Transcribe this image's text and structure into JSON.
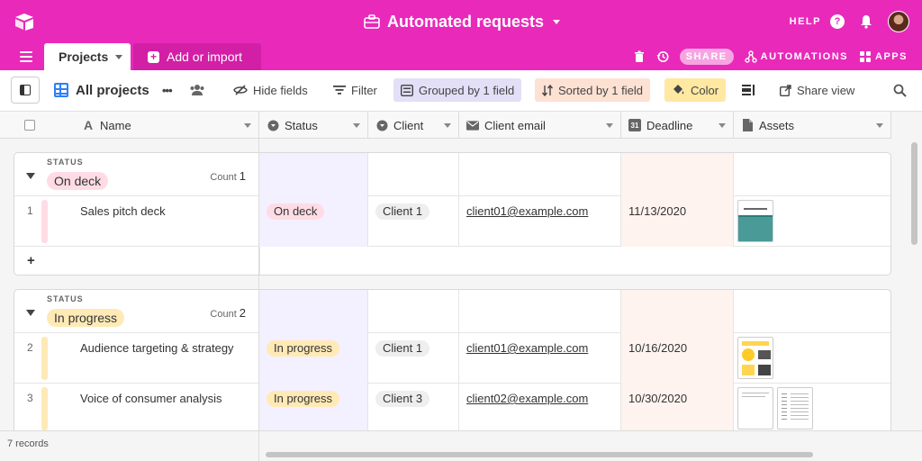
{
  "app": {
    "title": "Automated requests",
    "help_label": "HELP",
    "help_glyph": "?"
  },
  "tabs": {
    "active": "Projects",
    "add_import": "Add or import",
    "share": "SHARE",
    "automations": "AUTOMATIONS",
    "apps": "APPS"
  },
  "toolbar": {
    "view_name": "All projects",
    "more": "•••",
    "hide_fields": "Hide fields",
    "filter": "Filter",
    "grouped": "Grouped by 1 field",
    "sorted": "Sorted by 1 field",
    "color": "Color",
    "share_view": "Share view"
  },
  "columns": [
    {
      "label": "Name",
      "icon": "text-field-icon"
    },
    {
      "label": "Status",
      "icon": "single-select-icon"
    },
    {
      "label": "Client",
      "icon": "single-select-icon"
    },
    {
      "label": "Client email",
      "icon": "email-icon"
    },
    {
      "label": "Deadline",
      "icon": "calendar-icon"
    },
    {
      "label": "Assets",
      "icon": "attachment-icon"
    }
  ],
  "calendar_glyph": "31",
  "groups": [
    {
      "label": "STATUS",
      "value": "On deck",
      "count_label": "Count",
      "count": "1",
      "color": "#ffdce5",
      "rows": [
        {
          "num": "1",
          "name": "Sales pitch deck",
          "status": "On deck",
          "client": "Client 1",
          "email": "client01@example.com",
          "deadline": "11/13/2020"
        }
      ]
    },
    {
      "label": "STATUS",
      "value": "In progress",
      "count_label": "Count",
      "count": "2",
      "color": "#ffeab6",
      "rows": [
        {
          "num": "2",
          "name": "Audience targeting & strategy",
          "status": "In progress",
          "client": "Client 1",
          "email": "client01@example.com",
          "deadline": "10/16/2020"
        },
        {
          "num": "3",
          "name": "Voice of consumer analysis",
          "status": "In progress",
          "client": "Client 3",
          "email": "client02@example.com",
          "deadline": "10/30/2020"
        }
      ]
    }
  ],
  "add_row": "+",
  "footer": {
    "records": "7 records"
  },
  "colors": {
    "brand": "#e929ba",
    "brand_dark": "#d21fa6",
    "status_bg": "#f3f0ff",
    "deadline_bg": "#fff3ef"
  }
}
